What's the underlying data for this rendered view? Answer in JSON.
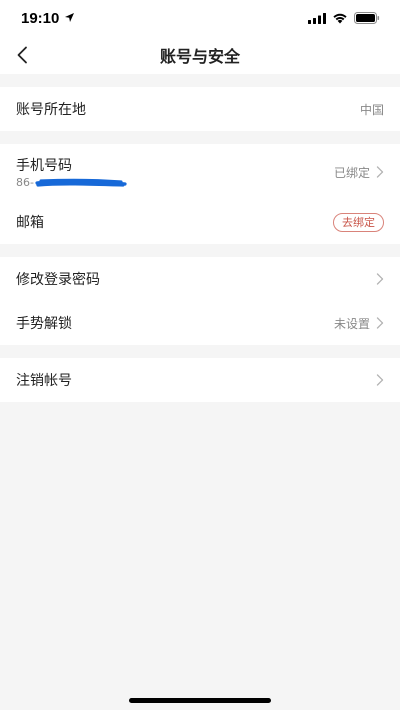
{
  "status_bar": {
    "time": "19:10"
  },
  "header": {
    "title": "账号与安全"
  },
  "groups": {
    "region": {
      "label": "账号所在地",
      "value": "中国"
    },
    "phone": {
      "label": "手机号码",
      "sub": "86-",
      "value": "已绑定"
    },
    "email": {
      "label": "邮箱",
      "action": "去绑定"
    },
    "password": {
      "label": "修改登录密码"
    },
    "gesture": {
      "label": "手势解锁",
      "value": "未设置"
    },
    "cancel": {
      "label": "注销帐号"
    }
  }
}
